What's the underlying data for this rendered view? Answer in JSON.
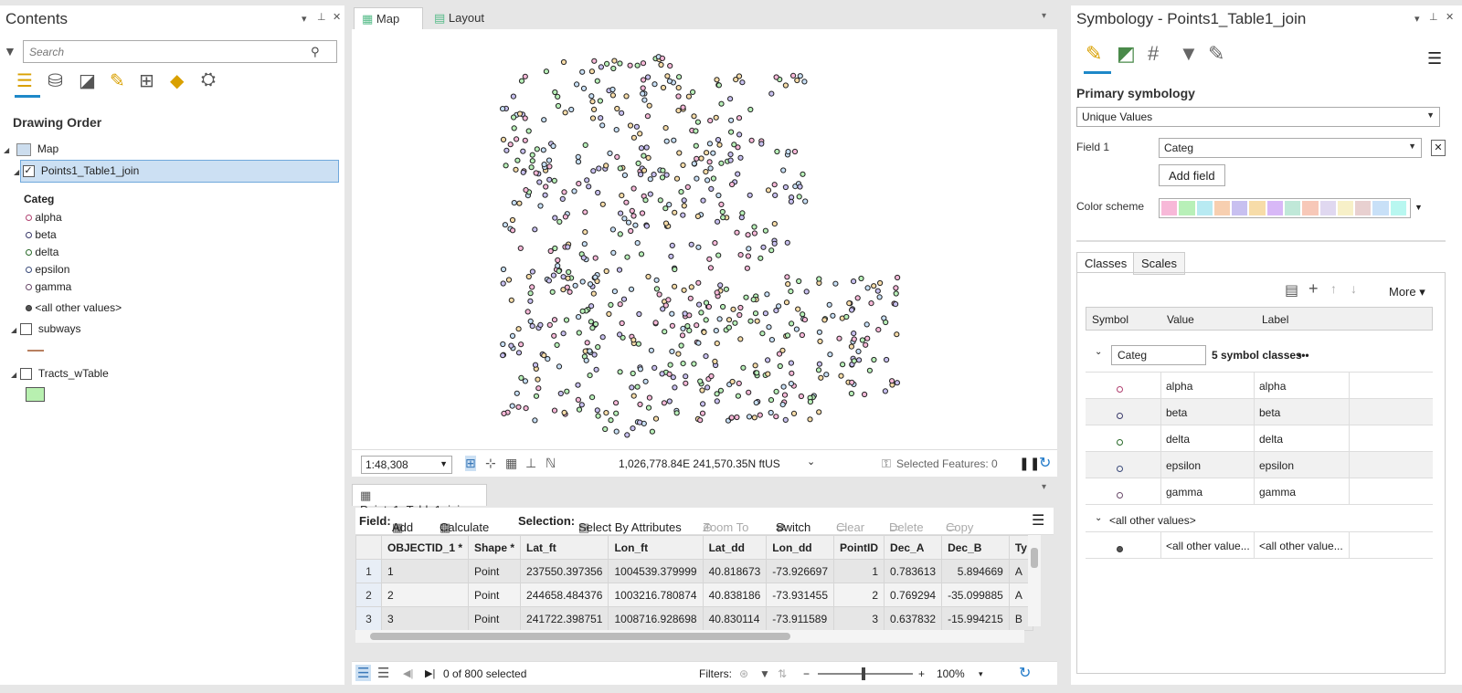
{
  "contents": {
    "title": "Contents",
    "search_placeholder": "Search",
    "drawing_order": "Drawing Order",
    "map_label": "Map",
    "layer1": "Points1_Table1_join",
    "categ_label": "Categ",
    "classes": [
      "alpha",
      "beta",
      "delta",
      "epsilon",
      "gamma"
    ],
    "all_other": "<all other values>",
    "layer2": "subways",
    "layer3": "Tracts_wTable"
  },
  "map": {
    "tab_map": "Map",
    "tab_layout": "Layout",
    "scale": "1:48,308",
    "coords": "1,026,778.84E 241,570.35N ftUS",
    "selected_features": "Selected Features: 0"
  },
  "table": {
    "tab": "Points1_Table1_join",
    "field_label": "Field:",
    "add": "Add",
    "calculate": "Calculate",
    "selection_label": "Selection:",
    "select_by_attr": "Select By Attributes",
    "zoom_to": "Zoom To",
    "switch": "Switch",
    "clear": "Clear",
    "delete": "Delete",
    "copy": "Copy",
    "columns": [
      "OBJECTID_1 *",
      "Shape *",
      "Lat_ft",
      "Lon_ft",
      "Lat_dd",
      "Lon_dd",
      "PointID",
      "Dec_A",
      "Dec_B",
      "Ty"
    ],
    "rows": [
      [
        "1",
        "1",
        "Point",
        "237550.397356",
        "1004539.379999",
        "40.818673",
        "-73.926697",
        "1",
        "0.783613",
        "5.894669",
        "A"
      ],
      [
        "2",
        "2",
        "Point",
        "244658.484376",
        "1003216.780874",
        "40.838186",
        "-73.931455",
        "2",
        "0.769294",
        "-35.099885",
        "A"
      ],
      [
        "3",
        "3",
        "Point",
        "241722.398751",
        "1008716.928698",
        "40.830114",
        "-73.911589",
        "3",
        "0.637832",
        "-15.994215",
        "B"
      ]
    ],
    "selected_count": "0 of 800 selected",
    "filters_label": "Filters:",
    "zoom": "100%"
  },
  "symbology": {
    "title": "Symbology - Points1_Table1_join",
    "primary": "Primary symbology",
    "method": "Unique Values",
    "field1_label": "Field 1",
    "field1_value": "Categ",
    "add_field": "Add field",
    "color_scheme_label": "Color scheme",
    "scheme_colors": [
      "#f7b8d8",
      "#b8f0b8",
      "#b8eaf2",
      "#f7cfb0",
      "#c8c0f0",
      "#f7dca8",
      "#d8b8f7",
      "#c0e8d8",
      "#f7c8b8",
      "#e0d8f0",
      "#f7f0c8",
      "#e8d0d0",
      "#c8e0f7",
      "#b8f7f0"
    ],
    "tab_classes": "Classes",
    "tab_scales": "Scales",
    "more": "More",
    "col_symbol": "Symbol",
    "col_value": "Value",
    "col_label": "Label",
    "group_name": "Categ",
    "symbol_count": "5 symbol classes",
    "ellipsis": "•••",
    "values": [
      "alpha",
      "beta",
      "delta",
      "epsilon",
      "gamma"
    ],
    "other_header": "<all other values>",
    "other_value": "<all other value...",
    "other_label": "<all other value..."
  }
}
